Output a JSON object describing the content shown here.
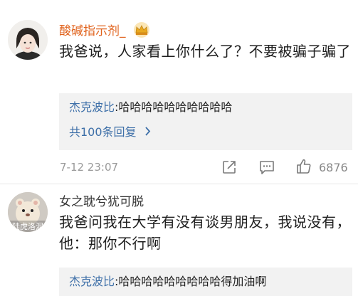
{
  "colors": {
    "vip_username": "#e0621c",
    "link": "#3d6fa8",
    "reply_bg": "#f2f2f2",
    "meta_gray": "#9a9a9a"
  },
  "comments": [
    {
      "username": "酸碱指示剂_",
      "badge_icon": "crown-icon",
      "text": "我爸说，人家看上你什么了？不要被骗子骗了",
      "reply": {
        "author": "杰克波比",
        "separator": ":",
        "text": "哈哈哈哈哈哈哈哈哈哈"
      },
      "more_replies": "共100条回复",
      "timestamp": "7-12 23:07",
      "share_icon": "share-icon",
      "comment_icon": "comment-icon",
      "like_icon": "thumbs-up-icon",
      "like_count": "6876"
    },
    {
      "username": "女之耽兮犹可脱",
      "avatar_text": "陆虎洛泥",
      "text": "我爸问我在大学有没有谈男朋友，我说没有，他：那你不行啊",
      "reply": {
        "author": "杰克波比",
        "separator": ":",
        "text": "哈哈哈哈哈哈哈哈哈得加油啊"
      }
    }
  ]
}
